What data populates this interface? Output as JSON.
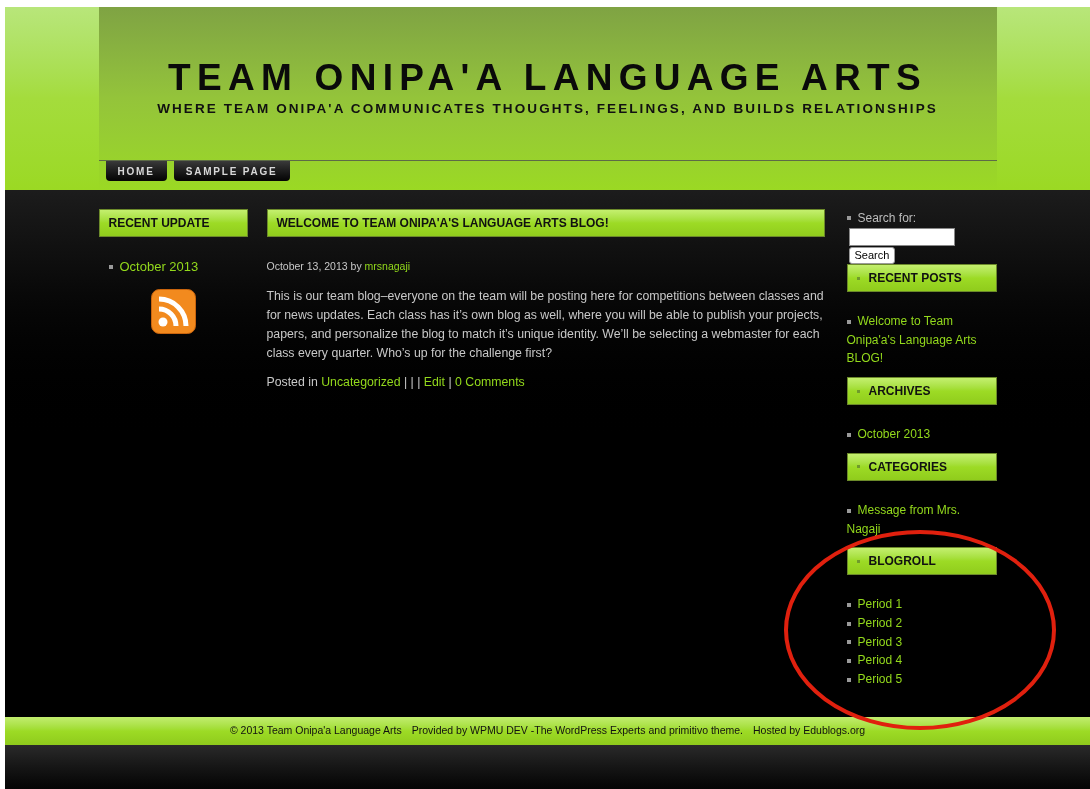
{
  "header": {
    "title": "TEAM ONIPA'A LANGUAGE ARTS",
    "tagline": "WHERE TEAM ONIPA'A COMMUNICATES THOUGHTS, FEELINGS, AND BUILDS RELATIONSHIPS"
  },
  "nav": [
    {
      "label": "HOME"
    },
    {
      "label": "SAMPLE PAGE"
    }
  ],
  "left_sidebar": {
    "heading": "RECENT UPDATE",
    "items": [
      "October 2013"
    ]
  },
  "post": {
    "title": "WELCOME TO TEAM ONIPA'A'S LANGUAGE ARTS BLOG!",
    "date": "October 13, 2013 by",
    "author": "mrsnagaji",
    "body": "This is our team blog–everyone on the team will be posting here for competitions between classes and for news updates. Each class has it’s own blog as well, where you will be able to publish your projects, papers, and personalize the blog to match it’s unique identity. We’ll be selecting a webmaster for each class every quarter. Who’s up for the challenge first?",
    "posted_in": "Posted in",
    "category": "Uncategorized",
    "separators": "| | |",
    "edit": "Edit",
    "separator": "|",
    "comments": "0 Comments"
  },
  "right_sidebar": {
    "search_label": "Search for:",
    "search_button": "Search",
    "widgets": [
      {
        "heading": "RECENT POSTS",
        "items": [
          "Welcome to Team Onipa'a's Language Arts BLOG!"
        ]
      },
      {
        "heading": "ARCHIVES",
        "items": [
          "October 2013"
        ]
      },
      {
        "heading": "CATEGORIES",
        "items": [
          "Message from Mrs. Nagaji"
        ]
      },
      {
        "heading": "BLOGROLL",
        "items": [
          "Period 1",
          "Period 2",
          "Period 3",
          "Period 4",
          "Period 5"
        ]
      }
    ]
  },
  "footer": [
    "© 2013 Team Onipa'a Language Arts",
    "Provided by WPMU DEV -The WordPress Experts and primitivo theme.",
    "Hosted by Edublogs.org"
  ]
}
